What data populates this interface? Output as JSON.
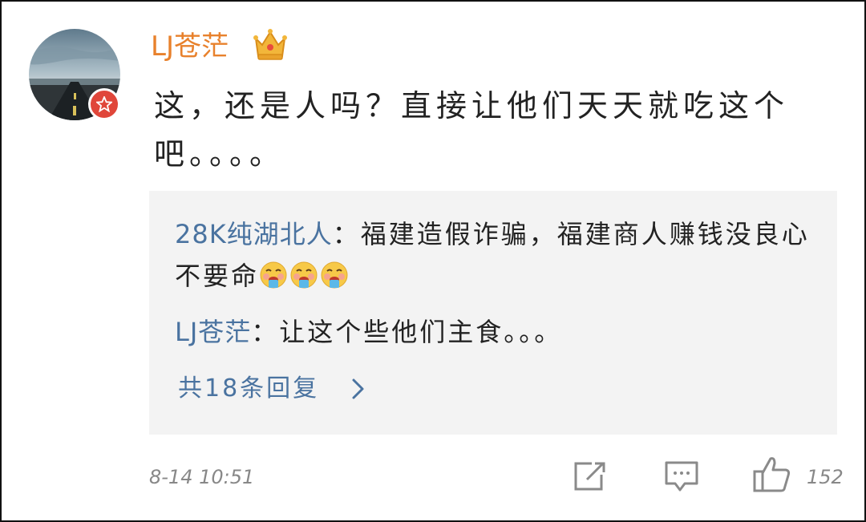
{
  "comment": {
    "username": "LJ苍茫",
    "text": "这，还是人吗？直接让他们天天就吃这个吧。。。。",
    "time": "8-14 10:51",
    "likes": "152"
  },
  "replies": [
    {
      "name": "28K纯湖北人",
      "sep": "：",
      "text": "福建造假诈骗，福建商人赚钱没良心不要命"
    },
    {
      "name": "LJ苍茫",
      "sep": "：",
      "text": "让这个些他们主食。。。"
    }
  ],
  "more_replies": "共18条回复",
  "icons": [
    "vip-crown-icon",
    "badge-star-icon",
    "drooling-emoji-icon",
    "chevron-right-icon",
    "share-icon",
    "comment-icon",
    "thumbs-up-icon"
  ],
  "colors": {
    "username": "#e8812c",
    "reply_name": "#4a73a0",
    "reply_bg": "#f3f3f3",
    "badge": "#e0463a"
  }
}
